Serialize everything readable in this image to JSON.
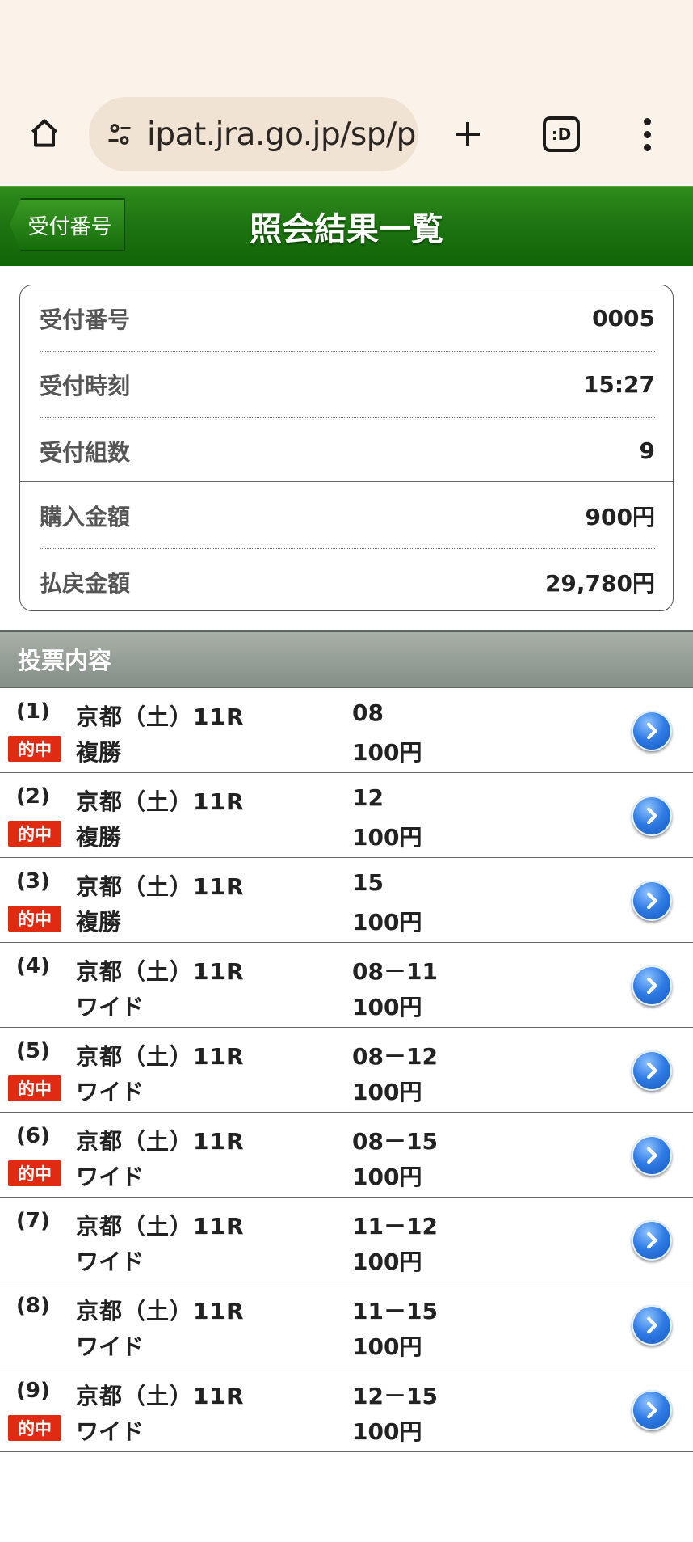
{
  "browser": {
    "url": "ipat.jra.go.jp/sp/p",
    "tabs_count": ":D",
    "icons": [
      "home-icon",
      "site-settings-icon",
      "plus-icon",
      "tab-switcher-icon",
      "more-vert-icon"
    ]
  },
  "header": {
    "back_label": "受付番号",
    "title": "照会結果一覧",
    "color": "#1f7512"
  },
  "summary": {
    "receipt_no_label": "受付番号",
    "receipt_no": "0005",
    "receipt_time_label": "受付時刻",
    "receipt_time": "15:27",
    "combos_label": "受付組数",
    "combos": "9",
    "purchase_label": "購入金額",
    "purchase": "900円",
    "payout_label": "払戻金額",
    "payout": "29,780円"
  },
  "section": {
    "title": "投票内容"
  },
  "hit_label": "的中",
  "bets": [
    {
      "num": "(1)",
      "race": "京都（土）11R",
      "type": "複勝",
      "combo": "08",
      "amount": "100円",
      "hit": true
    },
    {
      "num": "(2)",
      "race": "京都（土）11R",
      "type": "複勝",
      "combo": "12",
      "amount": "100円",
      "hit": true
    },
    {
      "num": "(3)",
      "race": "京都（土）11R",
      "type": "複勝",
      "combo": "15",
      "amount": "100円",
      "hit": true
    },
    {
      "num": "(4)",
      "race": "京都（土）11R",
      "type": "ワイド",
      "combo": "08－11",
      "amount": "100円",
      "hit": false
    },
    {
      "num": "(5)",
      "race": "京都（土）11R",
      "type": "ワイド",
      "combo": "08－12",
      "amount": "100円",
      "hit": true
    },
    {
      "num": "(6)",
      "race": "京都（土）11R",
      "type": "ワイド",
      "combo": "08－15",
      "amount": "100円",
      "hit": true
    },
    {
      "num": "(7)",
      "race": "京都（土）11R",
      "type": "ワイド",
      "combo": "11－12",
      "amount": "100円",
      "hit": false
    },
    {
      "num": "(8)",
      "race": "京都（土）11R",
      "type": "ワイド",
      "combo": "11－15",
      "amount": "100円",
      "hit": false
    },
    {
      "num": "(9)",
      "race": "京都（土）11R",
      "type": "ワイド",
      "combo": "12－15",
      "amount": "100円",
      "hit": true
    }
  ]
}
